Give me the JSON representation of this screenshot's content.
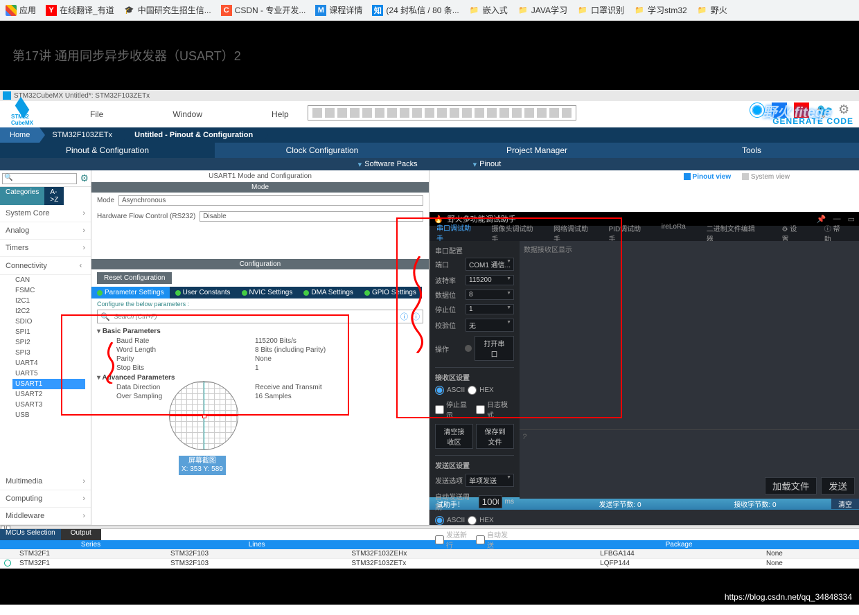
{
  "bookmarks": {
    "apps": "应用",
    "youdao": "在线翻译_有道",
    "grad": "中国研究生招生信...",
    "csdn_label": "CSDN - 专业开发...",
    "mooc_label": "课程详情",
    "zhihu_label": "(24 封私信 / 80 条...",
    "folders": [
      "嵌入式",
      "JAVA学习",
      "口罩识别",
      "学习stm32",
      "野火"
    ]
  },
  "video_title": "第17讲 通用同步异步收发器（USART）2",
  "app_title": "STM32CubeMX Untitled*: STM32F103ZETx",
  "menus": {
    "file": "File",
    "window": "Window",
    "help": "Help"
  },
  "gen_code": "GENERATE CODE",
  "watermark": "野火  fitege",
  "breadcrumb": {
    "home": "Home",
    "chip": "STM32F103ZETx",
    "page": "Untitled - Pinout & Configuration"
  },
  "main_tabs": [
    "Pinout & Configuration",
    "Clock Configuration",
    "Project Manager",
    "Tools"
  ],
  "sub_tabs": {
    "sw": "Software Packs",
    "pin": "Pinout"
  },
  "left": {
    "categories": "Categories",
    "az": "A->Z",
    "groups": {
      "system_core": "System Core",
      "analog": "Analog",
      "timers": "Timers",
      "connectivity": "Connectivity",
      "multimedia": "Multimedia",
      "computing": "Computing",
      "middleware": "Middleware"
    },
    "conn_items": [
      "CAN",
      "FSMC",
      "I2C1",
      "I2C2",
      "SDIO",
      "SPI1",
      "SPI2",
      "SPI3",
      "UART4",
      "UART5",
      "USART1",
      "USART2",
      "USART3",
      "USB"
    ]
  },
  "center": {
    "title": "USART1 Mode and Configuration",
    "mode_hdr": "Mode",
    "mode_label": "Mode",
    "mode_val": "Asynchronous",
    "hw_label": "Hardware Flow Control (RS232)",
    "hw_val": "Disable",
    "cfg_hdr": "Configuration",
    "reset": "Reset Configuration",
    "tabs": [
      "Parameter Settings",
      "User Constants",
      "NVIC Settings",
      "DMA Settings",
      "GPIO Settings"
    ],
    "note": "Configure the below parameters :",
    "search_ph": "Search (Ctrl+F)",
    "basic": "Basic Parameters",
    "p_baud": "Baud Rate",
    "v_baud": "115200 Bits/s",
    "p_wl": "Word Length",
    "v_wl": "8 Bits (including Parity)",
    "p_par": "Parity",
    "v_par": "None",
    "p_sb": "Stop Bits",
    "v_sb": "1",
    "adv": "Advanced Parameters",
    "p_dd": "Data Direction",
    "v_dd": "Receive and Transmit",
    "p_os": "Over Sampling",
    "v_os": "16 Samples",
    "coord1": "屏幕截图",
    "coord2": "X: 353 Y: 589"
  },
  "right": {
    "pinout_view": "Pinout view",
    "system_view": "System view"
  },
  "dark": {
    "title": "野火多功能调试助手",
    "tabs": [
      "串口调试助手",
      "摄像头调试助手",
      "网络调试助手",
      "PID调试助手"
    ],
    "rtabs": [
      "ireLoRa",
      "二进制文件编辑器"
    ],
    "settings": "设置",
    "help": "帮助",
    "sec_port": "串口配置",
    "port_lbl": "端口",
    "port_val": "COM1 通信...",
    "baud_lbl": "波特率",
    "baud_val": "115200",
    "data_lbl": "数据位",
    "data_val": "8",
    "stop_lbl": "停止位",
    "stop_val": "1",
    "parity_lbl": "校验位",
    "parity_val": "无",
    "oper_lbl": "操作",
    "open_btn": "打开串口",
    "sec_rcv": "接收区设置",
    "ascii": "ASCII",
    "hex": "HEX",
    "stop_disp": "停止显示",
    "log_mode": "日志模式",
    "clear_rcv": "清空接收区",
    "save_file": "保存到文件",
    "rcv_area": "数据接收区显示",
    "sec_send": "发送区设置",
    "send_opt_lbl": "发送选项",
    "send_opt_val": "单项发送",
    "auto_send_lbl": "自动发送周期",
    "auto_send_val": "1000",
    "ms": "ms",
    "send_nl": "发送新行",
    "auto_send": "自动发送",
    "load": "加载文件",
    "send_btn": "发送",
    "foot_tip": "试助手！",
    "foot_sent": "发送字节数: 0",
    "foot_rcv": "接收字节数: 0",
    "foot_clr": "清空"
  },
  "bottom": {
    "tab1": "MCUs Selection",
    "tab2": "Output",
    "cols": [
      "",
      "Series",
      "Lines",
      "",
      "Package",
      ""
    ],
    "r1": [
      "",
      "STM32F1",
      "STM32F103",
      "STM32F103ZEHx",
      "LFBGA144",
      "None"
    ],
    "r2": [
      "",
      "STM32F1",
      "STM32F103",
      "STM32F103ZETx",
      "LQFP144",
      "None"
    ]
  },
  "footer_url": "https://blog.csdn.net/qq_34848334"
}
